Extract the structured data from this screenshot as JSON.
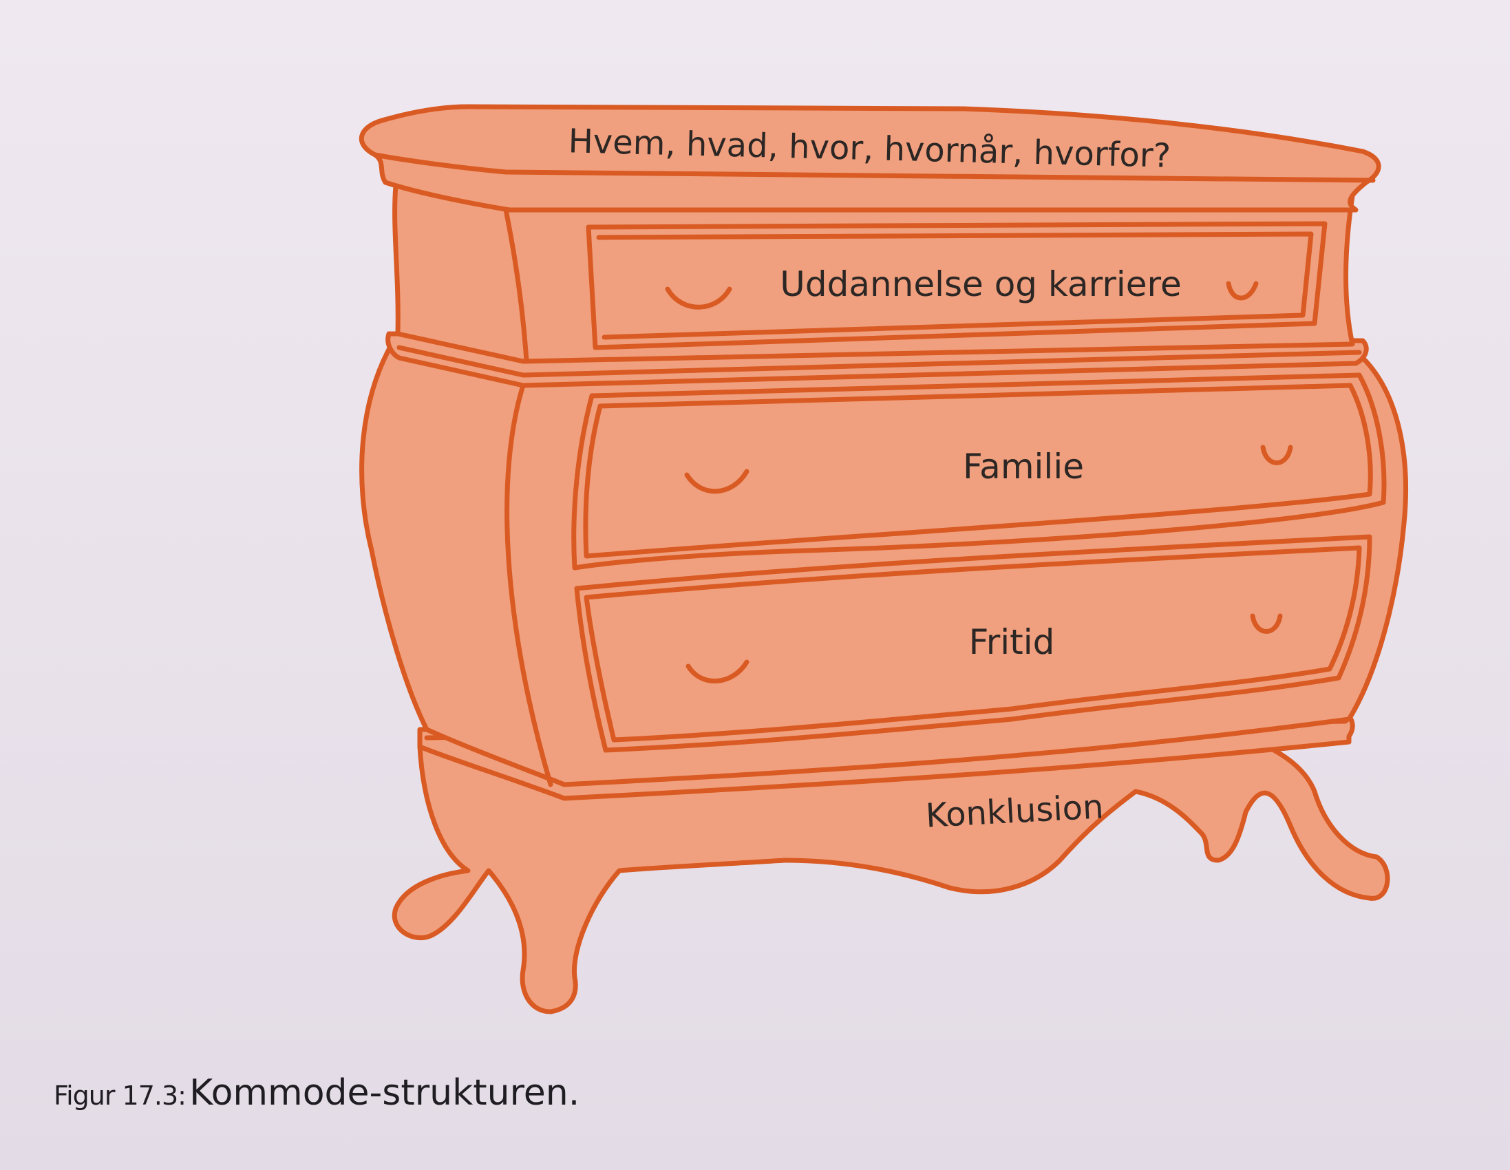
{
  "top_label": "Hvem, hvad, hvor, hvornår, hvorfor?",
  "drawers": [
    {
      "label": "Uddannelse og karriere"
    },
    {
      "label": "Familie"
    },
    {
      "label": "Fritid"
    }
  ],
  "base_label": "Konklusion",
  "caption": {
    "figure_number": "Figur 17.3:",
    "title": "Kommode-strukturen."
  },
  "colors": {
    "fill": "#f0a07e",
    "outline": "#d95a22",
    "text": "#2c2624"
  }
}
